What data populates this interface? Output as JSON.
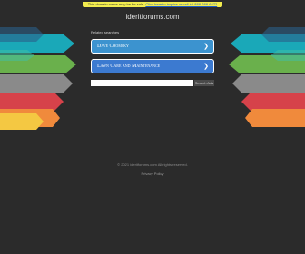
{
  "topbar": {
    "text": "This domain name may be for sale. ",
    "link": "Click here to inquire or call +1 888-288-6472"
  },
  "domain_name": "ideritforums.com",
  "related_label": "Related searches",
  "links": [
    {
      "label": "Dave Chomsky",
      "chevron": "❯"
    },
    {
      "label": "Lawn Care and Maintenance",
      "chevron": "❯"
    }
  ],
  "search": {
    "placeholder": "",
    "button_label": "Search Ads"
  },
  "footer": {
    "copyright": "© 2021 ideritforums.com All rights reserved.",
    "privacy": "Privacy Policy"
  },
  "colors": {
    "background": "#2b2b2b",
    "arrow_colors": [
      "#1aa8b8",
      "#3fc0a4",
      "#6ab04c",
      "#8a8a8a",
      "#d6424a",
      "#f08a3c",
      "#f4c842"
    ],
    "link_primary": "#3c93cf",
    "link_secondary": "#3c7ad0",
    "topbar": "#f2ec4e"
  },
  "icons": [
    "chevron-right-icon"
  ]
}
